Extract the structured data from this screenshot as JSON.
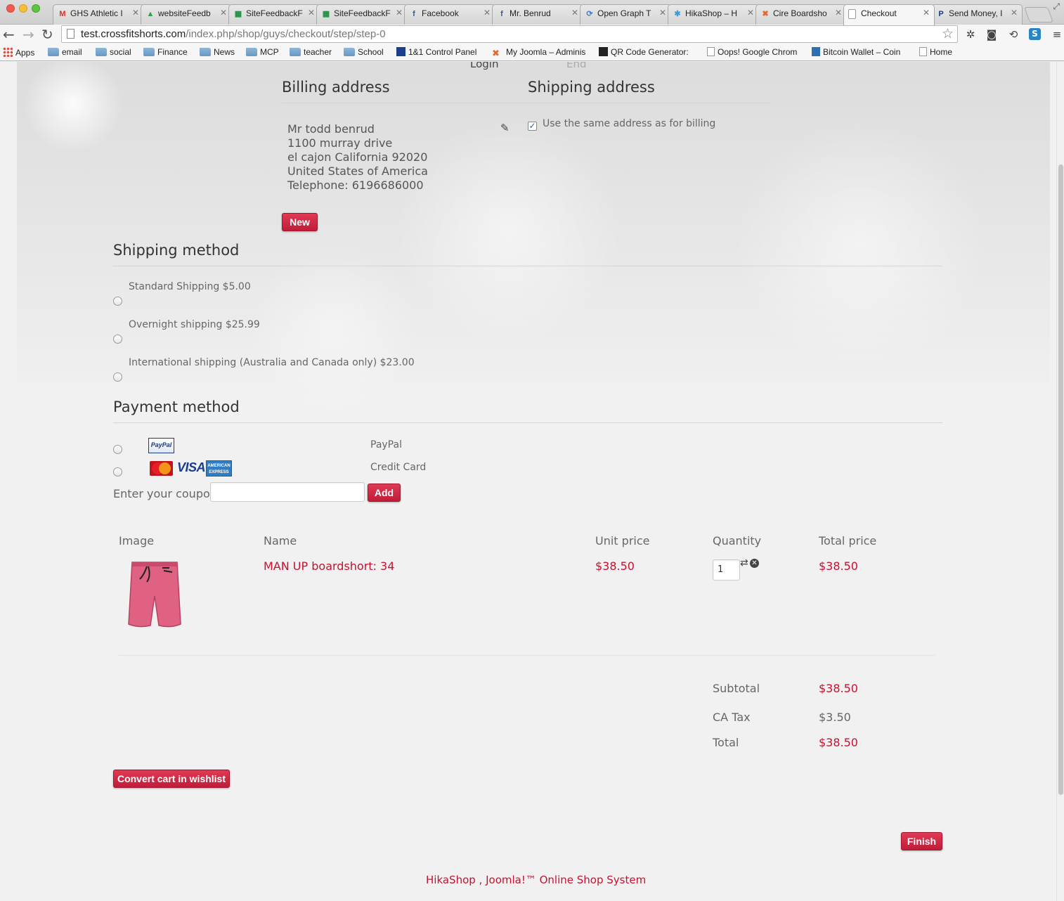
{
  "browser": {
    "tabs": [
      {
        "label": "GHS Athletic I",
        "icon": "gmail-icon",
        "icon_char": "M",
        "icon_color": "#d93025"
      },
      {
        "label": "websiteFeedb",
        "icon": "drive-icon",
        "icon_char": "▲",
        "icon_color": "#2d9f48"
      },
      {
        "label": "SiteFeedbackF",
        "icon": "sheets-icon",
        "icon_char": "▦",
        "icon_color": "#1e8e3e"
      },
      {
        "label": "SiteFeedbackF",
        "icon": "sheets-icon",
        "icon_char": "▦",
        "icon_color": "#1e8e3e"
      },
      {
        "label": "Facebook",
        "icon": "facebook-icon",
        "icon_char": "f",
        "icon_color": "#3b5998"
      },
      {
        "label": "Mr. Benrud",
        "icon": "facebook-icon",
        "icon_char": "f",
        "icon_color": "#3b5998"
      },
      {
        "label": "Open Graph T",
        "icon": "opengraph-icon",
        "icon_char": "⟳",
        "icon_color": "#3a7bd5"
      },
      {
        "label": "HikaShop – H",
        "icon": "hikashop-icon",
        "icon_char": "✱",
        "icon_color": "#3f9bd0"
      },
      {
        "label": "Cire Boardsho",
        "icon": "joomla-icon",
        "icon_char": "✖",
        "icon_color": "#e5672d"
      },
      {
        "label": "Checkout",
        "icon": "page-icon",
        "icon_char": "",
        "icon_color": "#ffffff",
        "active": true
      },
      {
        "label": "Send Money, I",
        "icon": "paypal-icon",
        "icon_char": "P",
        "icon_color": "#1a3a8a"
      }
    ],
    "url": {
      "host": "test.crossfitshorts.com",
      "path": "/index.php/shop/guys/checkout/step/step-0"
    },
    "bookmarks": [
      {
        "label": "Apps",
        "icon": "apps-icon"
      },
      {
        "label": "email",
        "icon": "folder-icon"
      },
      {
        "label": "social",
        "icon": "folder-icon"
      },
      {
        "label": "Finance",
        "icon": "folder-icon"
      },
      {
        "label": "News",
        "icon": "folder-icon"
      },
      {
        "label": "MCP",
        "icon": "folder-icon"
      },
      {
        "label": "teacher",
        "icon": "folder-icon"
      },
      {
        "label": "School",
        "icon": "folder-icon"
      },
      {
        "label": "1&1 Control Panel",
        "icon": "1and1-icon"
      },
      {
        "label": "My Joomla – Adminis",
        "icon": "joomla-icon"
      },
      {
        "label": "QR Code Generator:",
        "icon": "qr-icon"
      },
      {
        "label": "Oops! Google Chrom",
        "icon": "document-icon"
      },
      {
        "label": "Bitcoin Wallet – Coin",
        "icon": "coinbase-icon"
      },
      {
        "label": "Home",
        "icon": "document-icon"
      }
    ]
  },
  "steps": {
    "login": "Login",
    "end": "End"
  },
  "billing": {
    "title": "Billing address",
    "lines": [
      "Mr todd benrud",
      "1100 murray drive",
      "el cajon California 92020",
      "United States of America",
      "Telephone: 6196686000"
    ],
    "new_button": "New"
  },
  "shipping_address": {
    "title": "Shipping address",
    "same_as_billing_label": "Use the same address as for billing",
    "same_as_billing_checked": true
  },
  "shipping_method": {
    "title": "Shipping method",
    "options": [
      {
        "label": "Standard Shipping $5.00"
      },
      {
        "label": "Overnight shipping $25.99"
      },
      {
        "label": "International shipping (Australia and Canada only) $23.00"
      }
    ]
  },
  "payment_method": {
    "title": "Payment method",
    "options": [
      {
        "label": "PayPal",
        "logo": "PayPal"
      },
      {
        "label": "Credit Card",
        "logos": [
          "MasterCard",
          "VISA",
          "AMERICAN EXPRESS"
        ]
      }
    ]
  },
  "coupon": {
    "label": "Enter your coupon",
    "value": "",
    "button": "Add"
  },
  "cart": {
    "headers": {
      "image": "Image",
      "name": "Name",
      "unit_price": "Unit price",
      "quantity": "Quantity",
      "total_price": "Total price"
    },
    "items": [
      {
        "name": "MAN UP boardshort: 34",
        "unit_price": "$38.50",
        "quantity": "1",
        "total_price": "$38.50",
        "image": "pink boardshort"
      }
    ],
    "totals": [
      {
        "label": "Subtotal",
        "value": "$38.50"
      },
      {
        "label": "CA Tax",
        "value": "$3.50"
      },
      {
        "label": "Total",
        "value": "$38.50"
      }
    ]
  },
  "buttons": {
    "wishlist": "Convert cart in wishlist",
    "finish": "Finish"
  },
  "footer": {
    "text": "HikaShop , Joomla!™ Online Shop System"
  },
  "colors": {
    "accent": "#c8102e",
    "text": "#666666"
  }
}
